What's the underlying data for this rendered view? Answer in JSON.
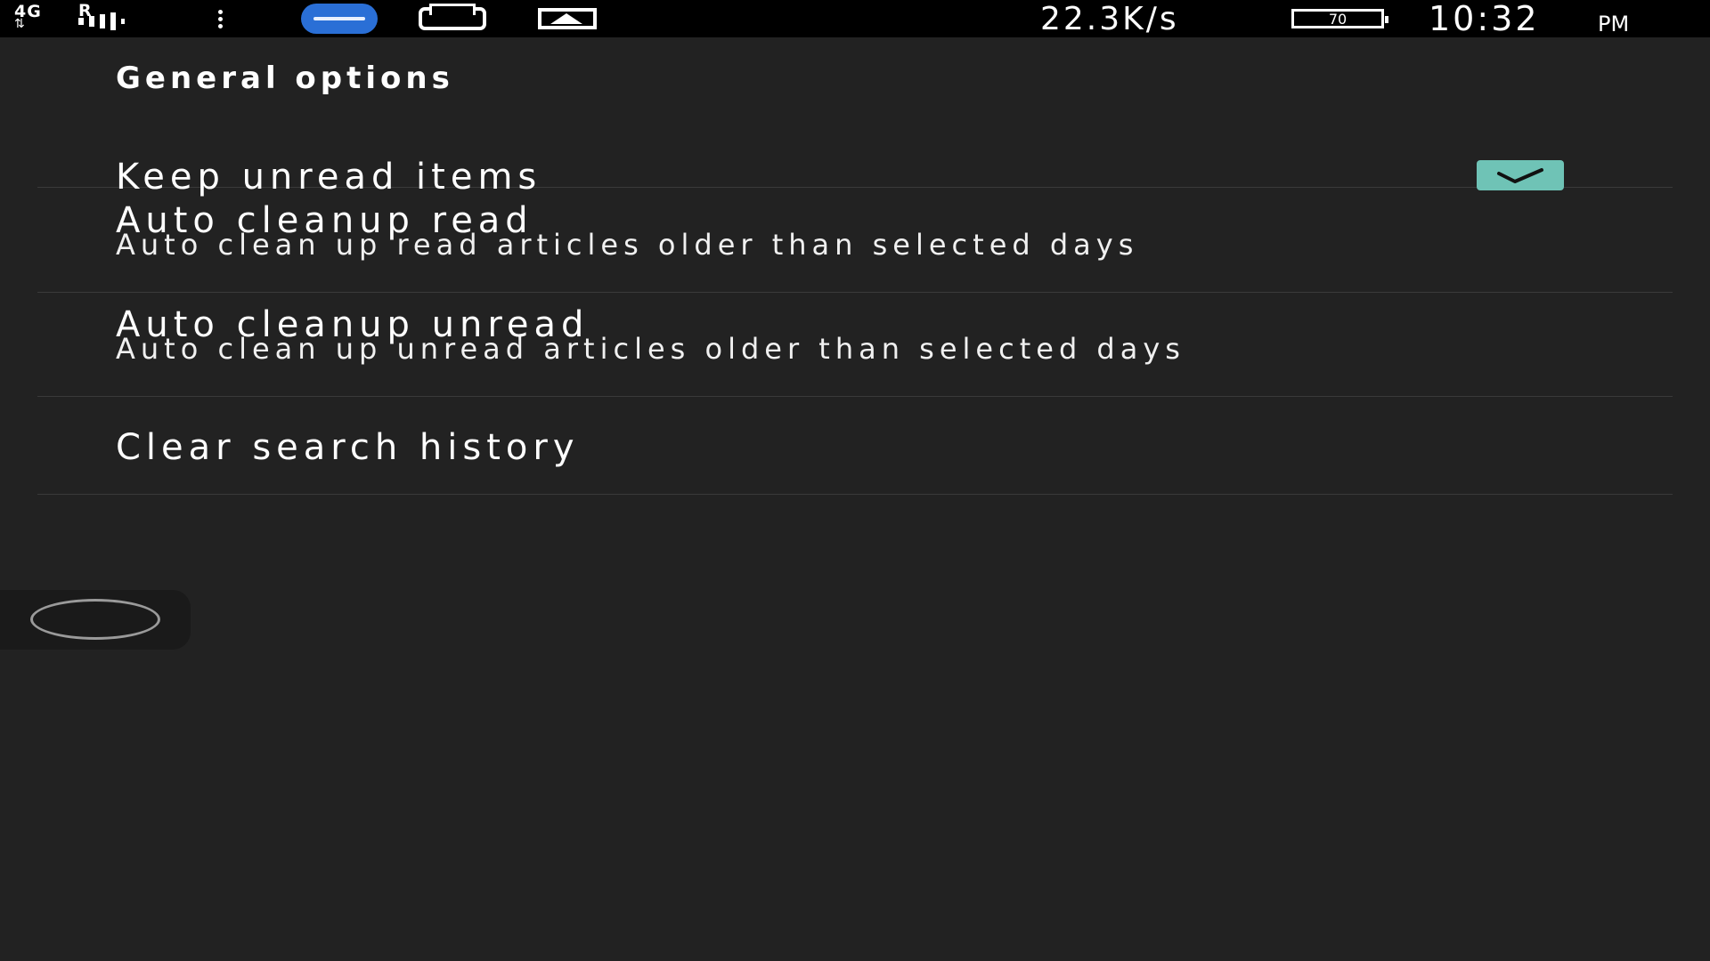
{
  "status_bar": {
    "network_type": "4G",
    "network_arrows": "⇅",
    "roaming": "R",
    "signal_icon": "signal-icon",
    "notification_icons": [
      "more-vert-icon",
      "app-s-icon",
      "printer-icon",
      "gallery-icon"
    ],
    "net_speed": "22.3K/s",
    "battery_level": "70",
    "time": "10:32",
    "ampm": "PM"
  },
  "settings": {
    "section_header": "General options",
    "items": [
      {
        "title": "Keep unread items",
        "summary": "",
        "checked": true
      },
      {
        "title": "Auto cleanup read",
        "summary": "Auto clean up read articles older than selected days"
      },
      {
        "title": "Auto cleanup unread",
        "summary": "Auto clean up unread articles older than selected days"
      },
      {
        "title": "Clear search history",
        "summary": ""
      }
    ]
  },
  "colors": {
    "background": "#222222",
    "status_bar": "#000000",
    "checkbox_accent": "#6fc3b6",
    "divider": "#3a3a3a"
  }
}
